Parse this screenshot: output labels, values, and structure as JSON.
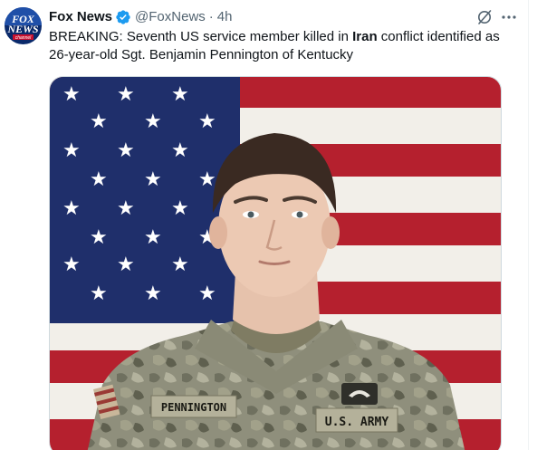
{
  "post": {
    "author_name": "Fox News",
    "handle": "@FoxNews",
    "separator": "·",
    "time": "4h",
    "text_before": "BREAKING: Seventh US service member killed in ",
    "text_bold": "Iran",
    "text_after": " conflict identified as 26-year-old Sgt. Benjamin Pennington of Kentucky"
  },
  "avatar": {
    "logo_line1": "FOX",
    "logo_line2": "NEWS",
    "logo_line3": "channel"
  },
  "photo": {
    "name_tape": "PENNINGTON",
    "branch_tape": "U.S. ARMY"
  },
  "colors": {
    "verified": "#1d9bf0",
    "secondary_text": "#536471",
    "flag_red": "#b5202e",
    "flag_blue": "#1f2f6b"
  },
  "icons": [
    "verified-badge-icon",
    "grok-icon",
    "more-icon"
  ]
}
